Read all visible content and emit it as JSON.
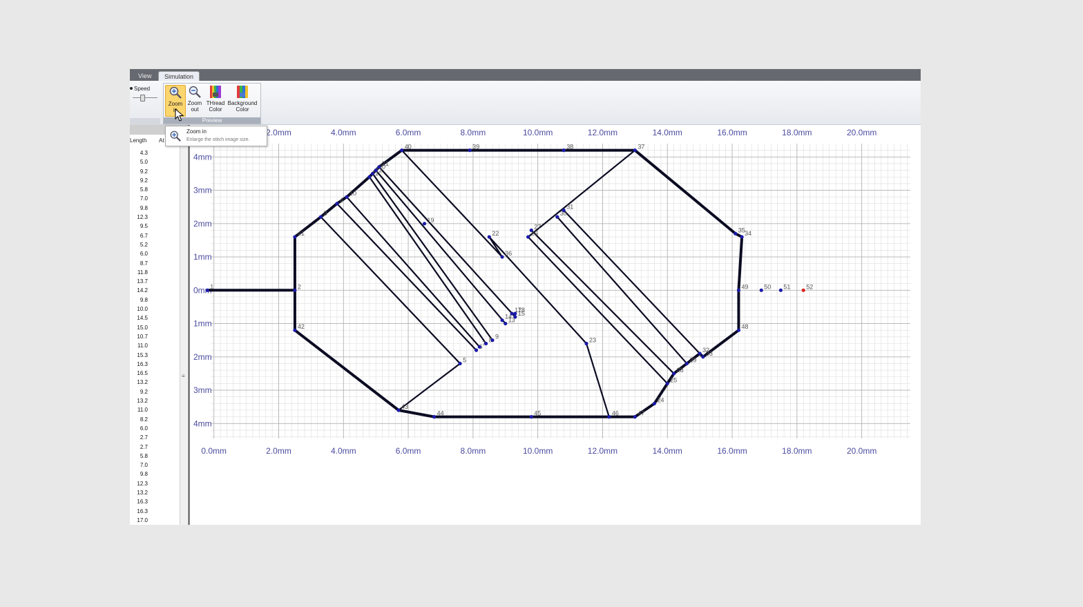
{
  "menu": {
    "tabs": [
      "View",
      "Simulation"
    ],
    "active": "Simulation"
  },
  "ribbon": {
    "speed_label": "Speed",
    "preview_group_label": "Preview",
    "buttons": {
      "zoom_in": [
        "Zoom",
        "in"
      ],
      "zoom_out": [
        "Zoom",
        "out"
      ],
      "thread_color": [
        "THread",
        "Color"
      ],
      "background_color": [
        "Background",
        "Color"
      ]
    }
  },
  "tooltip": {
    "title": "Zoom in",
    "description": "Enlarge the stitch image size."
  },
  "left_panel": {
    "columns": [
      "Length",
      "At"
    ],
    "lengths": [
      "4.3",
      "5.0",
      "9.2",
      "9.2",
      "5.8",
      "7.0",
      "9.8",
      "12.3",
      "9.5",
      "6.7",
      "5.2",
      "6.0",
      "8.7",
      "11.8",
      "13.7",
      "14.2",
      "9.8",
      "10.0",
      "14.5",
      "15.0",
      "10.7",
      "11.0",
      "15.3",
      "16.3",
      "16.5",
      "13.2",
      "9.2",
      "13.2",
      "11.0",
      "8.2",
      "6.0",
      "2.7",
      "2.7",
      "5.8",
      "7.0",
      "9.8",
      "12.3",
      "13.2",
      "16.3",
      "16.3",
      "17.0"
    ]
  },
  "colors": {
    "stitch": "#0b0b22",
    "point": "#1a1aa8",
    "current_point": "#dd2222",
    "grid_major": "#b3b3b3",
    "grid_minor": "#dddddd",
    "axis_label": "#4a4aa0"
  },
  "chart_data": {
    "type": "scatter",
    "x_tick_labels": [
      "0.0mm",
      "2.0mm",
      "4.0mm",
      "6.0mm",
      "8.0mm",
      "10.0mm",
      "12.0mm",
      "14.0mm",
      "16.0mm",
      "18.0mm",
      "20.0mm"
    ],
    "y_tick_labels": [
      "4mm",
      "3mm",
      "2mm",
      "1mm",
      "0mm",
      "1mm",
      "2mm",
      "3mm",
      "4mm"
    ],
    "xlim": [
      -0.1,
      21.5
    ],
    "ylim": [
      -4.45,
      4.4
    ],
    "x_ticks": [
      0,
      2,
      4,
      6,
      8,
      10,
      12,
      14,
      16,
      18,
      20
    ],
    "y_ticks": [
      4,
      3,
      2,
      1,
      0,
      -1,
      -2,
      -3,
      -4
    ],
    "points": [
      [
        1,
        -0.2,
        0
      ],
      [
        2,
        2.5,
        0
      ],
      [
        3,
        3.3,
        2.2
      ],
      [
        4,
        3.8,
        2.6
      ],
      [
        5,
        7.6,
        -2.2
      ],
      [
        6,
        8.1,
        -1.8
      ],
      [
        7,
        8.2,
        -1.7
      ],
      [
        8,
        8.4,
        -1.6
      ],
      [
        9,
        8.6,
        -1.5
      ],
      [
        10,
        4.1,
        2.8
      ],
      [
        11,
        4.8,
        3.4
      ],
      [
        12,
        4.9,
        3.5
      ],
      [
        13,
        9.0,
        -1.0
      ],
      [
        14,
        8.9,
        -0.9
      ],
      [
        15,
        9.3,
        -0.8
      ],
      [
        17,
        9.2,
        -0.7
      ],
      [
        18,
        9.3,
        -0.7
      ],
      [
        19,
        6.5,
        2.0
      ],
      [
        20,
        5.0,
        3.6
      ],
      [
        21,
        5.1,
        3.7
      ],
      [
        22,
        8.5,
        1.6
      ],
      [
        23,
        11.5,
        -1.6
      ],
      [
        24,
        13.6,
        -3.4
      ],
      [
        25,
        14.0,
        -2.8
      ],
      [
        26,
        9.7,
        1.6
      ],
      [
        27,
        9.8,
        1.8
      ],
      [
        28,
        14.2,
        -2.5
      ],
      [
        29,
        14.6,
        -2.2
      ],
      [
        30,
        10.6,
        2.2
      ],
      [
        31,
        10.8,
        2.4
      ],
      [
        32,
        15.0,
        -1.9
      ],
      [
        33,
        15.1,
        -2.0
      ],
      [
        34,
        16.3,
        1.6
      ],
      [
        35,
        16.1,
        1.7
      ],
      [
        36,
        8.9,
        1.0
      ],
      [
        37,
        13.0,
        4.2
      ],
      [
        38,
        10.8,
        4.2
      ],
      [
        39,
        7.9,
        4.2
      ],
      [
        40,
        5.8,
        4.2
      ],
      [
        41,
        2.5,
        1.6
      ],
      [
        42,
        2.5,
        -1.2
      ],
      [
        43,
        5.7,
        -3.6
      ],
      [
        44,
        6.8,
        -3.8
      ],
      [
        45,
        9.8,
        -3.8
      ],
      [
        46,
        12.2,
        -3.8
      ],
      [
        47,
        13.0,
        -3.8
      ],
      [
        48,
        16.2,
        -1.2
      ],
      [
        49,
        16.2,
        0
      ],
      [
        50,
        16.9,
        0
      ],
      [
        51,
        17.5,
        0
      ],
      [
        52,
        18.2,
        0
      ]
    ],
    "current_point": 52,
    "stitch_path": [
      1,
      2,
      42,
      43,
      44,
      45,
      46,
      47,
      24,
      25,
      28,
      29,
      32,
      33,
      48,
      49,
      34,
      35,
      37,
      38,
      39,
      40,
      21,
      20,
      12,
      11,
      10,
      4,
      3,
      41,
      2
    ]
  }
}
